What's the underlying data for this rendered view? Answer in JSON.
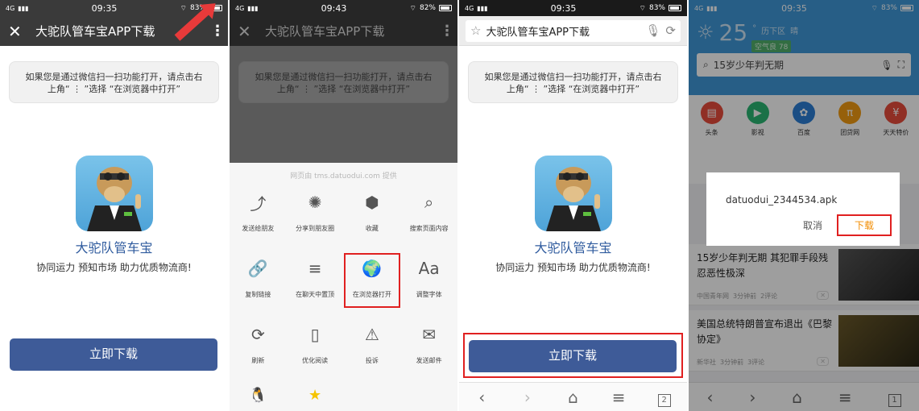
{
  "colors": {
    "primary_button": "#3e5b98",
    "highlight": "#e02020",
    "app_name": "#2f5b9e",
    "browser_top": "#3f98d8"
  },
  "screen1": {
    "status": {
      "signal": "4G",
      "time": "09:35",
      "battery": "83%"
    },
    "header": {
      "title": "大驼队管车宝APP下载"
    },
    "notice": {
      "line1": "如果您是通过微信扫一扫功能打开，请点击右",
      "line2": "上角“ ⋮ ”选择 “在浏览器中打开”"
    },
    "app_name": "大驼队管车宝",
    "slogan": "协同运力 预知市场 助力优质物流商!",
    "download_label": "立即下载"
  },
  "screen2": {
    "status": {
      "signal": "4G",
      "time": "09:43",
      "battery": "82%"
    },
    "header": {
      "title": "大驼队管车宝APP下载"
    },
    "notice": {
      "line1": "如果您是通过微信扫一扫功能打开，请点击右",
      "line2": "上角“ ⋮ ”选择 “在浏览器中打开”"
    },
    "sheet_source": "网页由 tms.datuodui.com 提供",
    "menu": [
      {
        "label": "发送给朋友",
        "icon": "share-icon",
        "glyph": "⤴"
      },
      {
        "label": "分享到朋友圈",
        "icon": "aperture-icon",
        "glyph": "✺"
      },
      {
        "label": "收藏",
        "icon": "cube-icon",
        "glyph": "⬢"
      },
      {
        "label": "搜索页面内容",
        "icon": "search-icon",
        "glyph": "⌕"
      },
      {
        "label": "复制链接",
        "icon": "link-icon",
        "glyph": "🔗"
      },
      {
        "label": "在聊天中置顶",
        "icon": "pin-top-icon",
        "glyph": "≡"
      },
      {
        "label": "在浏览器打开",
        "icon": "globe-icon",
        "glyph": "🌍"
      },
      {
        "label": "调整字体",
        "icon": "font-icon",
        "glyph": "Aa"
      },
      {
        "label": "刷新",
        "icon": "refresh-icon",
        "glyph": "⟳"
      },
      {
        "label": "优化阅读",
        "icon": "book-icon",
        "glyph": "▯"
      },
      {
        "label": "投诉",
        "icon": "warning-icon",
        "glyph": "⚠"
      },
      {
        "label": "发送邮件",
        "icon": "mail-icon",
        "glyph": "✉"
      }
    ]
  },
  "screen3": {
    "status": {
      "signal": "4G",
      "time": "09:35",
      "battery": "83%"
    },
    "url_title": "大驼队管车宝APP下载",
    "notice": {
      "line1": "如果您是通过微信扫一扫功能打开，请点击右",
      "line2": "上角“ ⋮ ”选择 “在浏览器中打开”"
    },
    "app_name": "大驼队管车宝",
    "slogan": "协同运力 预知市场 助力优质物流商!",
    "download_label": "立即下载",
    "tab_count": "2"
  },
  "screen4": {
    "status": {
      "signal": "4G",
      "time": "09:35",
      "battery": "83%"
    },
    "weather": {
      "temp": "25",
      "unit": "°",
      "location": "历下区",
      "condition": "晴",
      "air": "空气良 78"
    },
    "search_text": "15岁少年判无期",
    "apps": [
      {
        "label": "头条",
        "color": "#e84c3d",
        "glyph": "▤"
      },
      {
        "label": "影视",
        "color": "#2bb673",
        "glyph": "▶"
      },
      {
        "label": "百度",
        "color": "#2d7fd6",
        "glyph": "✿"
      },
      {
        "label": "团贷网",
        "color": "#f39c12",
        "glyph": "π"
      },
      {
        "label": "天天特价",
        "color": "#e84c3d",
        "glyph": "¥"
      }
    ],
    "news": [
      {
        "title": "15岁少年判无期 其犯罪手段残忍恶性极深",
        "source": "中国青年网",
        "time": "3分钟前",
        "comments": "2评论"
      },
      {
        "title": "美国总统特朗普宣布退出《巴黎协定》",
        "source": "新华社",
        "time": "3分钟前",
        "comments": "3评论"
      }
    ],
    "dialog": {
      "filename": "datuodui_2344534.apk",
      "cancel": "取消",
      "confirm": "下载"
    },
    "tab_count": "1"
  }
}
